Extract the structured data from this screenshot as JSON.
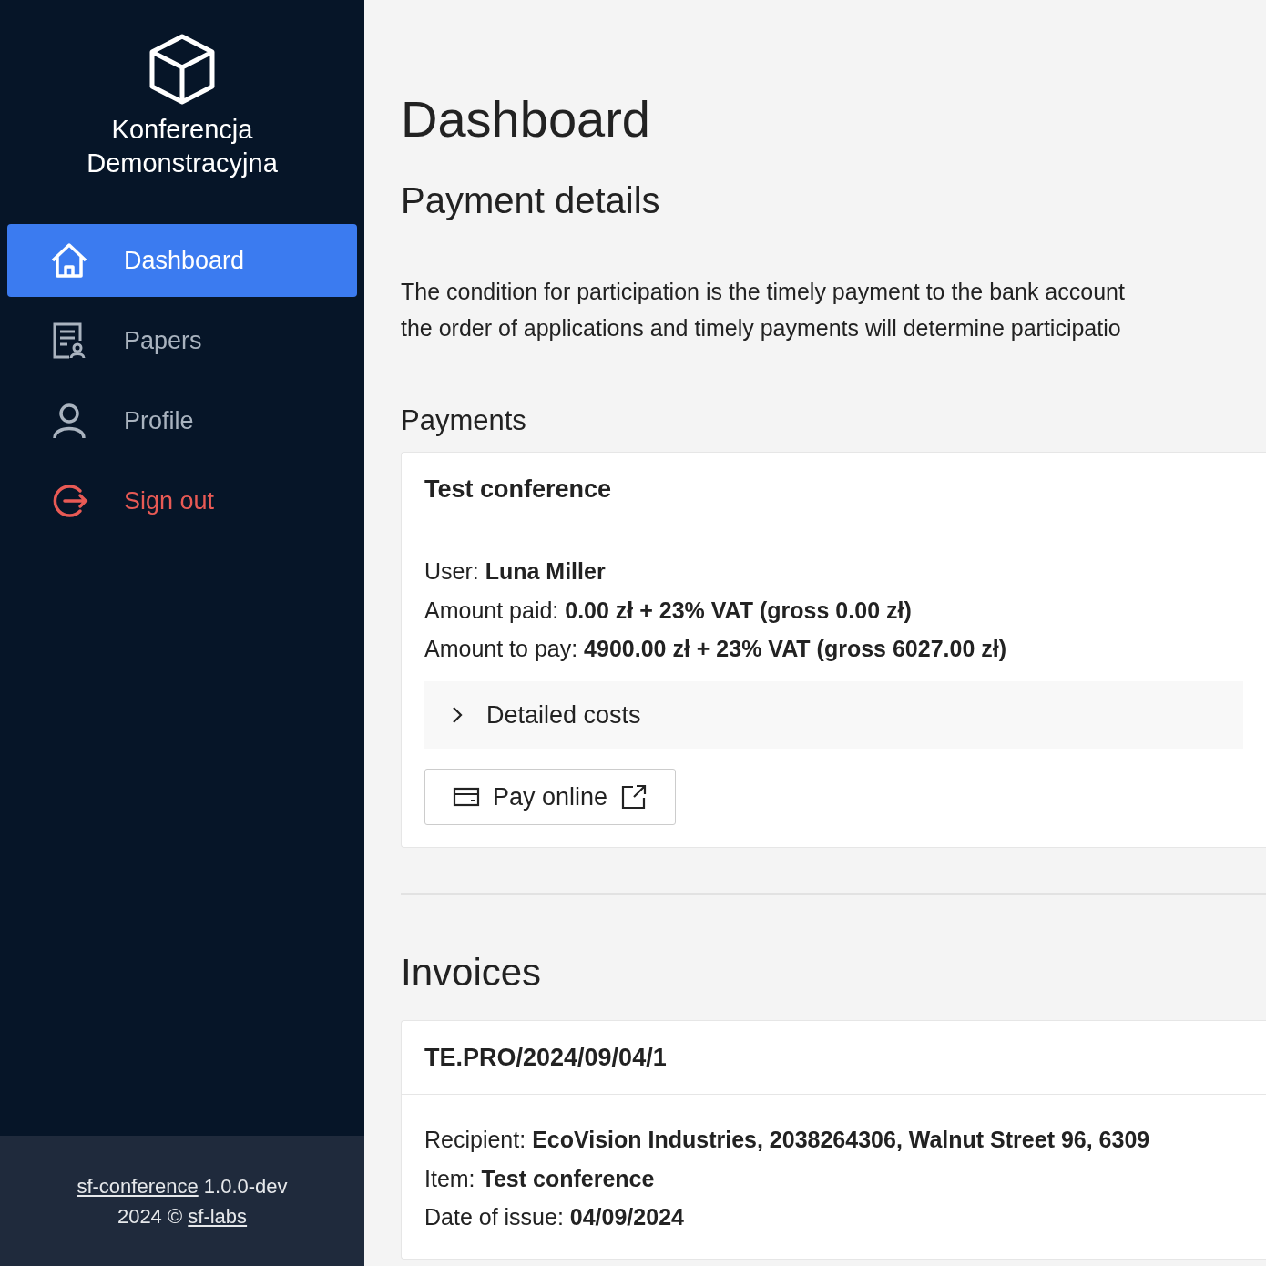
{
  "sidebar": {
    "brand": [
      "Konferencja",
      "Demonstracyjna"
    ],
    "items": [
      {
        "label": "Dashboard",
        "kind": "link",
        "selected": true
      },
      {
        "label": "Papers",
        "kind": "link",
        "selected": false
      },
      {
        "label": "Profile",
        "kind": "link",
        "selected": false
      },
      {
        "label": "Sign out",
        "kind": "danger",
        "selected": false
      }
    ],
    "footer": {
      "app_link": "sf-conference",
      "version": "1.0.0-dev",
      "copyright": "2024 ©",
      "org_link": "sf-labs"
    }
  },
  "main": {
    "title": "Dashboard",
    "subtitle": "Payment details",
    "intro": [
      "The condition for participation is the timely payment to the bank account",
      "the order of applications and timely payments will determine participatio"
    ],
    "payments": {
      "heading": "Payments",
      "card": {
        "title": "Test conference",
        "lines": [
          "User: **Luna Miller**",
          "Amount paid: **0.00 zł + 23% VAT (gross 0.00 zł)**",
          "Amount to pay: **4900.00 zł + 23% VAT (gross 6027.00 zł)**"
        ],
        "details": {
          "label": "Detailed costs",
          "expanded": false
        },
        "button": "Pay online"
      }
    },
    "invoices": {
      "heading": "Invoices",
      "card": {
        "title": "TE.PRO/2024/09/04/1",
        "lines": [
          "Recipient: **EcoVision Industries, 2038264306, Walnut Street 96, 6309**",
          "Item: **Test conference**",
          "Date of issue: **04/09/2024**"
        ]
      }
    }
  }
}
